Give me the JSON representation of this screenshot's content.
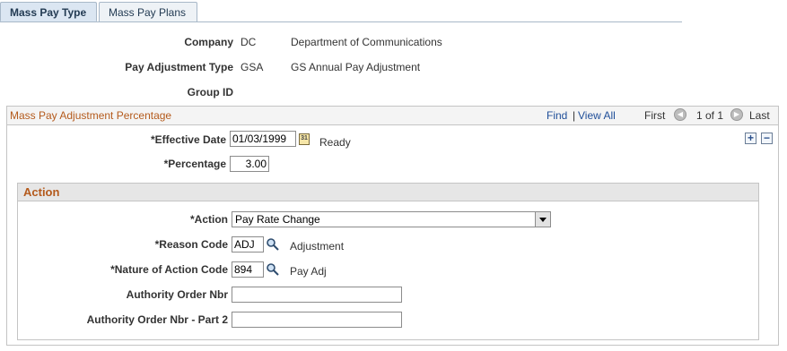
{
  "tabs": [
    {
      "label": "Mass Pay Type",
      "active": true
    },
    {
      "label": "Mass Pay Plans",
      "active": false
    }
  ],
  "header": {
    "company_label": "Company",
    "company_code": "DC",
    "company_desc": "Department of Communications",
    "pay_adj_label": "Pay Adjustment Type",
    "pay_adj_code": "GSA",
    "pay_adj_desc": "GS Annual Pay Adjustment",
    "group_id_label": "Group ID"
  },
  "scroll": {
    "title": "Mass Pay Adjustment Percentage",
    "find": "Find",
    "sep": "|",
    "view_all": "View All",
    "first": "First",
    "counter": "1 of 1",
    "last": "Last",
    "effective_date_label": "*Effective Date",
    "effective_date": "01/03/1999",
    "status": "Ready",
    "percentage_label": "*Percentage",
    "percentage": "3.00",
    "add": "+",
    "remove": "−"
  },
  "action": {
    "title": "Action",
    "action_label": "*Action",
    "action_value": "Pay Rate Change",
    "reason_label": "*Reason Code",
    "reason_code": "ADJ",
    "reason_desc": "Adjustment",
    "noa_label": "*Nature of Action Code",
    "noa_code": "894",
    "noa_desc": "Pay Adj",
    "auth_label": "Authority Order Nbr",
    "auth_value": "",
    "auth2_label": "Authority Order Nbr - Part 2",
    "auth2_value": ""
  },
  "colors": {
    "section_title": "#b45a1c",
    "link": "#1f4e99",
    "tab_active_bg": "#dbe6f2"
  },
  "icons": {
    "calendar": "calendar-icon",
    "lookup": "magnifier-icon",
    "prev": "prev-circle-icon",
    "next": "next-circle-icon"
  }
}
